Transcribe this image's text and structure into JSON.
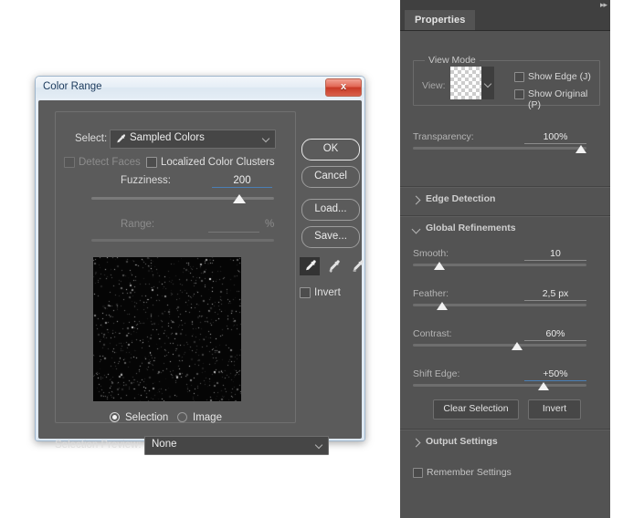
{
  "dialog": {
    "title": "Color Range",
    "close_label": "x",
    "select_label": "Select:",
    "select_value": "Sampled Colors",
    "select_icon": "eyedropper-icon",
    "detect_faces_label": "Detect Faces",
    "detect_faces_enabled": false,
    "localized_clusters_label": "Localized Color Clusters",
    "fuzziness_label": "Fuzziness:",
    "fuzziness_value": "200",
    "fuzziness_percent": 81,
    "range_label": "Range:",
    "range_value": "",
    "range_unit": "%",
    "range_percent": 0,
    "preview_mode_selection": "Selection",
    "preview_mode_image": "Image",
    "preview_selected": "Selection",
    "selection_preview_label": "Selection Preview:",
    "selection_preview_value": "None",
    "buttons": {
      "ok": "OK",
      "cancel": "Cancel",
      "load": "Load...",
      "save": "Save..."
    },
    "invert_label": "Invert",
    "droppers": [
      "eyedropper-icon",
      "eyedropper-add-icon",
      "eyedropper-subtract-icon"
    ]
  },
  "properties_panel": {
    "tab_label": "Properties",
    "collapse_icon": "collapse-panel-icon",
    "view_mode": {
      "legend": "View Mode",
      "view_label": "View:",
      "thumbnail": "transparency-checkerboard",
      "show_edge_label": "Show Edge (J)",
      "show_original_label": "Show Original (P)"
    },
    "transparency": {
      "label": "Transparency:",
      "value": "100%",
      "percent": 97
    },
    "sections": {
      "edge_detection": {
        "title": "Edge Detection",
        "expanded": false
      },
      "global_refinements": {
        "title": "Global Refinements",
        "expanded": true
      },
      "output_settings": {
        "title": "Output Settings",
        "expanded": false
      }
    },
    "smooth": {
      "label": "Smooth:",
      "value": "10",
      "percent": 15
    },
    "feather": {
      "label": "Feather:",
      "value": "2,5 px",
      "percent": 17
    },
    "contrast": {
      "label": "Contrast:",
      "value": "60%",
      "percent": 60
    },
    "shift_edge": {
      "label": "Shift Edge:",
      "value": "+50%",
      "percent": 75
    },
    "clear_selection_label": "Clear Selection",
    "invert_label": "Invert",
    "remember_settings_label": "Remember Settings"
  },
  "colors": {
    "panel_bg": "#535353",
    "panel_header_bg": "#404040",
    "dialog_inner_bg": "#5b5b5b",
    "titlebar_light": "#e8eff7",
    "close_red": "#c83a26",
    "scrubby_blue": "#4a7fb5",
    "knob_white": "#f2f2f2",
    "preview_black": "#050505",
    "desktop_white": "#ffffff"
  }
}
